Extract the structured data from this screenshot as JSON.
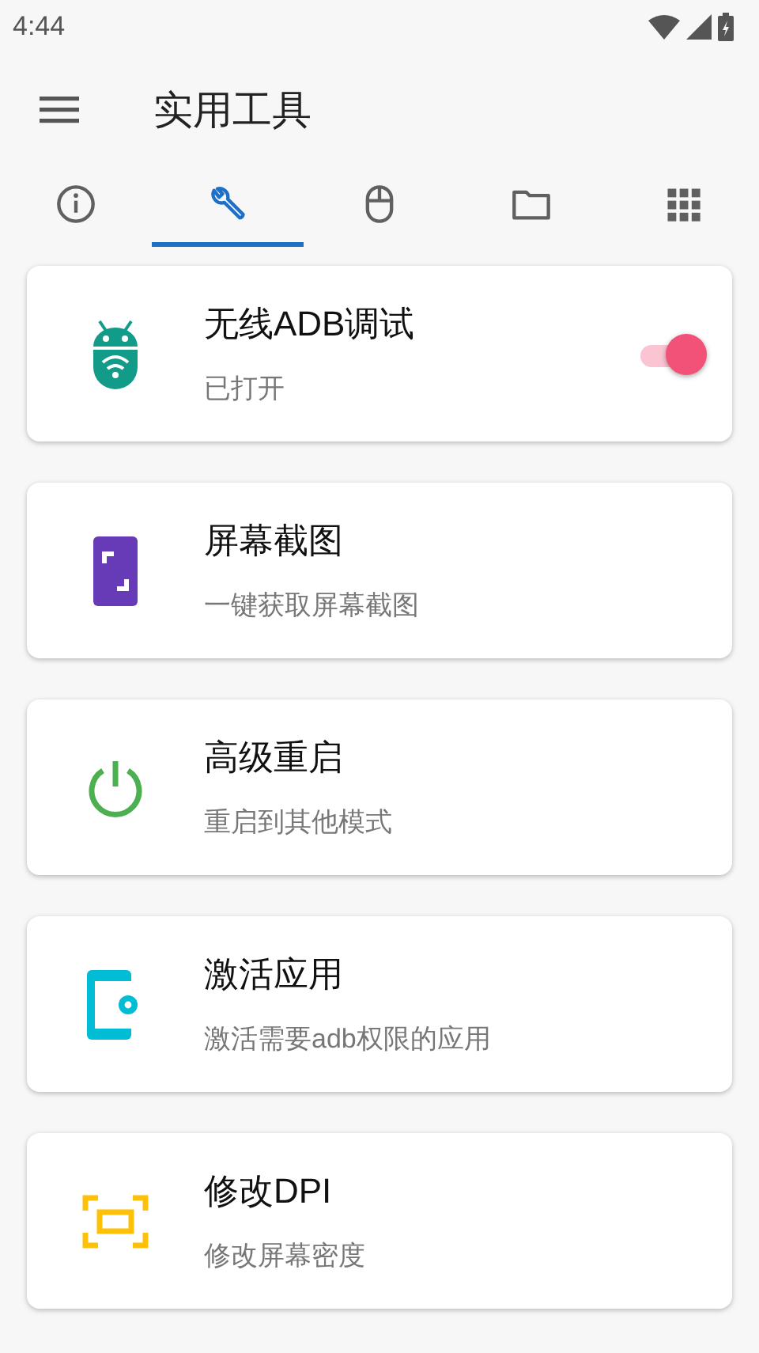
{
  "status_bar": {
    "time": "4:44"
  },
  "app_bar": {
    "title": "实用工具"
  },
  "tabs": [
    {
      "kind": "info",
      "selected": false
    },
    {
      "kind": "tools",
      "selected": true
    },
    {
      "kind": "mouse",
      "selected": false
    },
    {
      "kind": "folder",
      "selected": false
    },
    {
      "kind": "apps",
      "selected": false
    }
  ],
  "cards": [
    {
      "kind": "adb",
      "color": "#129b88",
      "title": "无线ADB调试",
      "subtitle": "已打开",
      "switch": {
        "on": true
      }
    },
    {
      "kind": "screenshot",
      "color": "#673ab7",
      "title": "屏幕截图",
      "subtitle": "一键获取屏幕截图"
    },
    {
      "kind": "power",
      "color": "#4caf50",
      "title": "高级重启",
      "subtitle": "重启到其他模式"
    },
    {
      "kind": "activate",
      "color": "#00bcd4",
      "title": "激活应用",
      "subtitle": "激活需要adb权限的应用"
    },
    {
      "kind": "dpi",
      "color": "#ffc107",
      "title": "修改DPI",
      "subtitle": "修改屏幕密度"
    }
  ]
}
